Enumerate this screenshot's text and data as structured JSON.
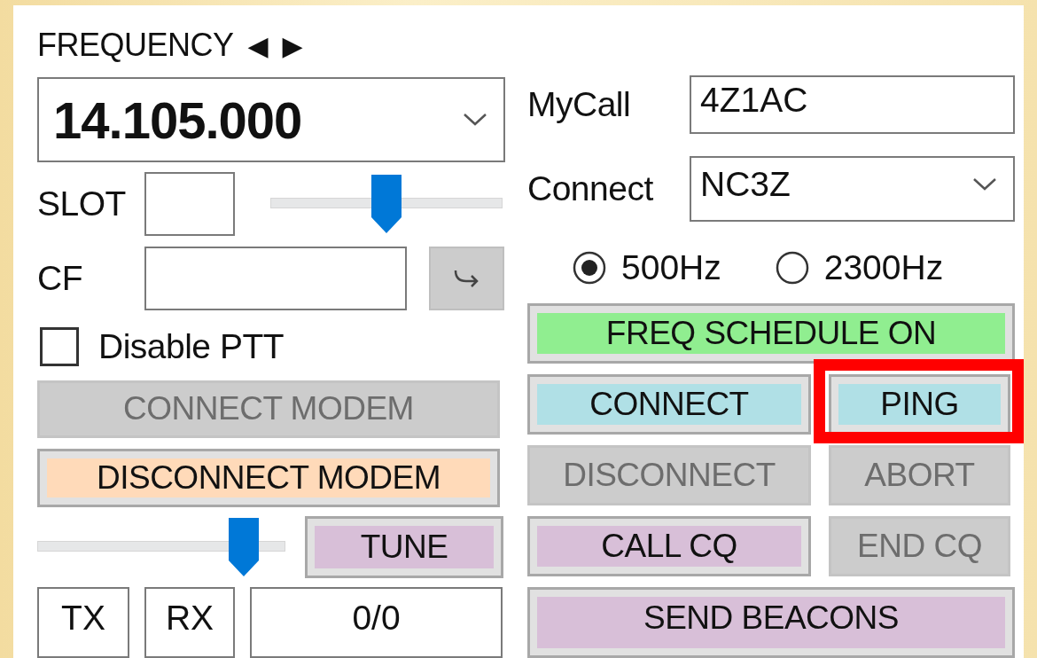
{
  "frequency": {
    "label": "FREQUENCY",
    "arrows": [
      "◀",
      "▶"
    ],
    "value": "14.105.000"
  },
  "slot": {
    "label": "SLOT",
    "value_slider": {
      "level": 0.5
    }
  },
  "cf": {
    "label": "CF"
  },
  "disable_ptt": {
    "label": "Disable PTT",
    "checked": false
  },
  "left_buttons": [
    {
      "label": "CONNECT MODEM",
      "disabled": true,
      "color": "#cccccc"
    },
    {
      "label": "DISCONNECT MODEM",
      "disabled": false,
      "color": "#ffdab9"
    }
  ],
  "tune": {
    "label": "TUNE",
    "color": "#d8bfd8",
    "slider": {
      "level": 0.88
    }
  },
  "indicators": [
    "TX",
    "RX",
    "0/0"
  ],
  "mycall": {
    "label": "MyCall",
    "value": "4Z1AC"
  },
  "connect": {
    "label": "Connect",
    "value": "NC3Z"
  },
  "bandwidth": [
    {
      "label": "500Hz",
      "selected": true
    },
    {
      "label": "2300Hz",
      "selected": false
    }
  ],
  "button_rows": [
    [
      {
        "label": "FREQ SCHEDULE ON",
        "disabled": false,
        "color": "#90ee90",
        "highlighted": false
      }
    ],
    [
      {
        "label": "CONNECT",
        "disabled": false,
        "color": "#b0e0e6",
        "highlighted": false
      },
      {
        "label": "PING",
        "disabled": false,
        "color": "#b0e0e6",
        "highlighted": true
      }
    ],
    [
      {
        "label": "DISCONNECT",
        "disabled": true,
        "color": "#cccccc",
        "highlighted": false
      },
      {
        "label": "ABORT",
        "disabled": true,
        "color": "#cccccc",
        "highlighted": false
      }
    ],
    [
      {
        "label": "CALL CQ",
        "disabled": false,
        "color": "#d8bfd8",
        "highlighted": false
      },
      {
        "label": "END CQ",
        "disabled": true,
        "color": "#cccccc",
        "highlighted": false
      }
    ],
    [
      {
        "label": "SEND BEACONS",
        "disabled": false,
        "color": "#d8bfd8",
        "highlighted": false
      }
    ]
  ]
}
